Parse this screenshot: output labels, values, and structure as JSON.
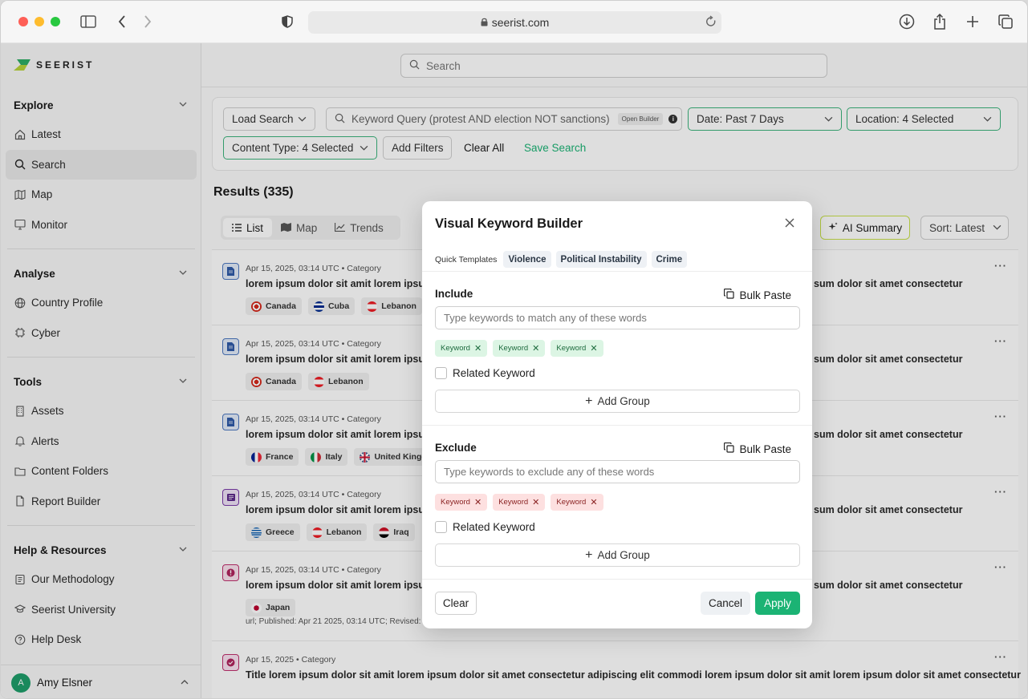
{
  "browser": {
    "url": "seerist.com"
  },
  "app": {
    "logo_text": "SEERIST"
  },
  "sidebar": {
    "sections": [
      {
        "title": "Explore",
        "items": [
          "Latest",
          "Search",
          "Map",
          "Monitor"
        ]
      },
      {
        "title": "Analyse",
        "items": [
          "Country Profile",
          "Cyber"
        ]
      },
      {
        "title": "Tools",
        "items": [
          "Assets",
          "Alerts",
          "Content Folders",
          "Report Builder"
        ]
      },
      {
        "title": "Help & Resources",
        "items": [
          "Our Methodology",
          "Seerist University",
          "Help Desk"
        ]
      }
    ],
    "active_item": "Search",
    "user": {
      "initial": "A",
      "name": "Amy Elsner"
    }
  },
  "search": {
    "placeholder": "Search"
  },
  "filters": {
    "load_search": "Load Search",
    "keyword_placeholder": "Keyword Query (protest AND election NOT sanctions)",
    "open_builder": "Open Builder",
    "date": "Date: Past 7 Days",
    "location": "Location: 4 Selected",
    "content_type": "Content Type: 4 Selected",
    "add_filters": "Add Filters",
    "clear_all": "Clear All",
    "save_search": "Save Search"
  },
  "results": {
    "title": "Results (335)",
    "tabs": [
      "List",
      "Map",
      "Trends"
    ],
    "active_tab": "List",
    "ai_summary": "AI Summary",
    "sort": "Sort: Latest",
    "items": [
      {
        "meta": "Apr 15, 2025, 03:14 UTC • Category",
        "title_left": "lorem ipsum dolor sit amit lorem ipsum",
        "title_right": "sum dolor sit amet consectetur",
        "tags": [
          "Canada",
          "Cuba",
          "Lebanon"
        ],
        "url_text": ""
      },
      {
        "meta": "Apr 15, 2025, 03:14 UTC • Category",
        "title_left": "lorem ipsum dolor sit amit lorem ipsum",
        "title_right": "sum dolor sit amet consectetur",
        "tags": [
          "Canada",
          "Lebanon"
        ],
        "url_text": ""
      },
      {
        "meta": "Apr 15, 2025, 03:14 UTC • Category",
        "title_left": "lorem ipsum dolor sit amit lorem ipsum",
        "title_right": "sum dolor sit amet consectetur",
        "tags": [
          "France",
          "Italy",
          "United Kingdo"
        ],
        "url_text": ""
      },
      {
        "meta": "Apr 15, 2025, 03:14 UTC • Category",
        "title_left": "lorem ipsum dolor sit amit lorem ipsum",
        "title_right": "sum dolor sit amet consectetur",
        "tags": [
          "Greece",
          "Lebanon",
          "Iraq"
        ],
        "url_text": ""
      },
      {
        "meta": "Apr 15, 2025, 03:14 UTC • Category",
        "title_left": "lorem ipsum dolor sit amit lorem ipsum",
        "title_right": "sum dolor sit amet consectetur",
        "tags": [
          "Japan"
        ],
        "url_text": "url; Published: Apr 21 2025, 03:14 UTC; Revised:"
      },
      {
        "meta": "Apr 15, 2025 • Category",
        "title_left": "Title lorem ipsum dolor sit amit lorem ipsum dolor sit amet consectetur adipiscing elit commodi lorem ipsum dolor sit amit lorem ipsum dolor sit amet consectetur",
        "title_right": "",
        "tags": [],
        "url_text": ""
      }
    ]
  },
  "modal": {
    "title": "Visual Keyword Builder",
    "quick_templates_label": "Quick Templates",
    "quick_templates": [
      "Violence",
      "Political Instability",
      "Crime"
    ],
    "include": {
      "label": "Include",
      "bulk_paste": "Bulk Paste",
      "placeholder": "Type keywords to match any of these words",
      "chips": [
        "Keyword",
        "Keyword",
        "Keyword"
      ],
      "related": "Related Keyword",
      "add_group": "Add Group"
    },
    "exclude": {
      "label": "Exclude",
      "bulk_paste": "Bulk Paste",
      "placeholder": "Type keywords to exclude any of these words",
      "chips": [
        "Keyword",
        "Keyword",
        "Keyword"
      ],
      "related": "Related Keyword",
      "add_group": "Add Group"
    },
    "clear": "Clear",
    "cancel": "Cancel",
    "apply": "Apply"
  },
  "colors": {
    "accent": "#1bb374",
    "ai_border": "#c7e04a"
  }
}
